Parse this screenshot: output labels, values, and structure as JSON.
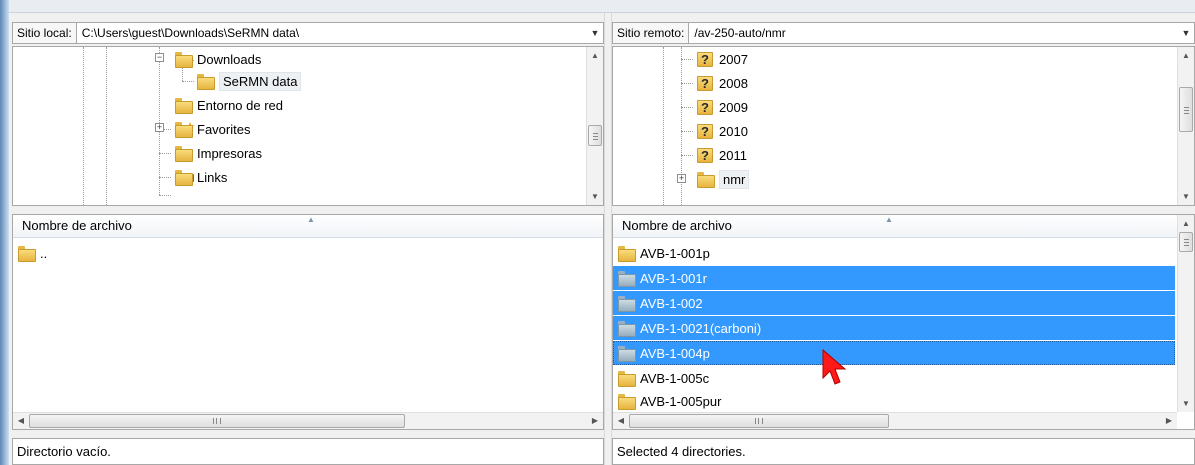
{
  "local": {
    "site_label": "Sitio local:",
    "path": "C:\\Users\\guest\\Downloads\\SeRMN data\\",
    "tree": [
      {
        "label": "Downloads",
        "icon": "downloads-folder-icon",
        "expanded": true
      },
      {
        "label": "SeRMN data",
        "icon": "folder-icon",
        "selected": true
      },
      {
        "label": "Entorno de red",
        "icon": "folder-icon"
      },
      {
        "label": "Favorites",
        "icon": "favorites-folder-icon",
        "collapsed": true
      },
      {
        "label": "Impresoras",
        "icon": "folder-icon"
      },
      {
        "label": "Links",
        "icon": "links-folder-icon"
      }
    ],
    "column_header": "Nombre de archivo",
    "files": [
      ".."
    ],
    "status": "Directorio vacío."
  },
  "remote": {
    "site_label": "Sitio remoto:",
    "path": "/av-250-auto/nmr",
    "tree": [
      {
        "label": "2007",
        "icon": "unknown-folder-icon"
      },
      {
        "label": "2008",
        "icon": "unknown-folder-icon"
      },
      {
        "label": "2009",
        "icon": "unknown-folder-icon"
      },
      {
        "label": "2010",
        "icon": "unknown-folder-icon"
      },
      {
        "label": "2011",
        "icon": "unknown-folder-icon"
      },
      {
        "label": "nmr",
        "icon": "folder-icon",
        "collapsed": true
      }
    ],
    "column_header": "Nombre de archivo",
    "files": [
      {
        "name": "AVB-1-001p",
        "selected": false
      },
      {
        "name": "AVB-1-001r",
        "selected": true
      },
      {
        "name": "AVB-1-002",
        "selected": true
      },
      {
        "name": "AVB-1-0021(carboni)",
        "selected": true
      },
      {
        "name": "AVB-1-004p",
        "selected": true
      },
      {
        "name": "AVB-1-005c",
        "selected": false
      },
      {
        "name": "AVB-1-005pur",
        "selected": false
      }
    ],
    "status": "Selected 4 directories."
  },
  "icons": {
    "dropdown": "chevron-down-icon",
    "cursor": "mouse-pointer-icon",
    "expand": "plus-expander-icon",
    "collapse": "minus-expander-icon"
  },
  "colors": {
    "selection": "#3399ff",
    "folder": "#f2cd62",
    "window_edge": "#5d87b4"
  }
}
